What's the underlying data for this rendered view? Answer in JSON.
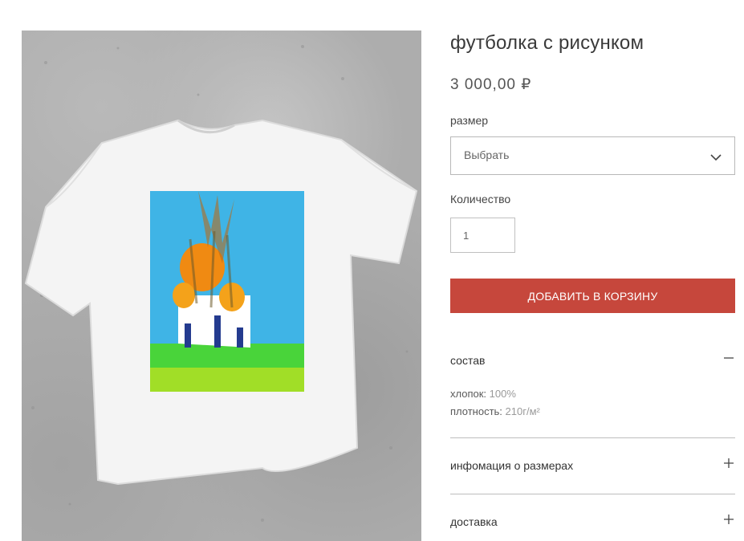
{
  "product": {
    "title": "футболка с рисунком",
    "price": "3 000,00 ₽"
  },
  "size": {
    "label": "размер",
    "selected": "Выбрать"
  },
  "quantity": {
    "label": "Количество",
    "value": "1"
  },
  "add_to_cart_label": "ДОБАВИТЬ В КОРЗИНУ",
  "accordion": {
    "composition": {
      "title": "состав",
      "expanded": true,
      "lines": [
        {
          "key": "хлопок:",
          "value": "100%"
        },
        {
          "key": "плотность:",
          "value": "210г/м²"
        }
      ]
    },
    "size_info": {
      "title": "инфомация о размерах",
      "expanded": false
    },
    "delivery": {
      "title": "доставка",
      "expanded": false
    }
  },
  "icons": {
    "select_arrow": "chevron-down-icon",
    "expanded": "minus-icon",
    "collapsed": "plus-icon"
  },
  "colors": {
    "button": "#c6473c",
    "background": "#ffffff",
    "text": "#333333"
  }
}
